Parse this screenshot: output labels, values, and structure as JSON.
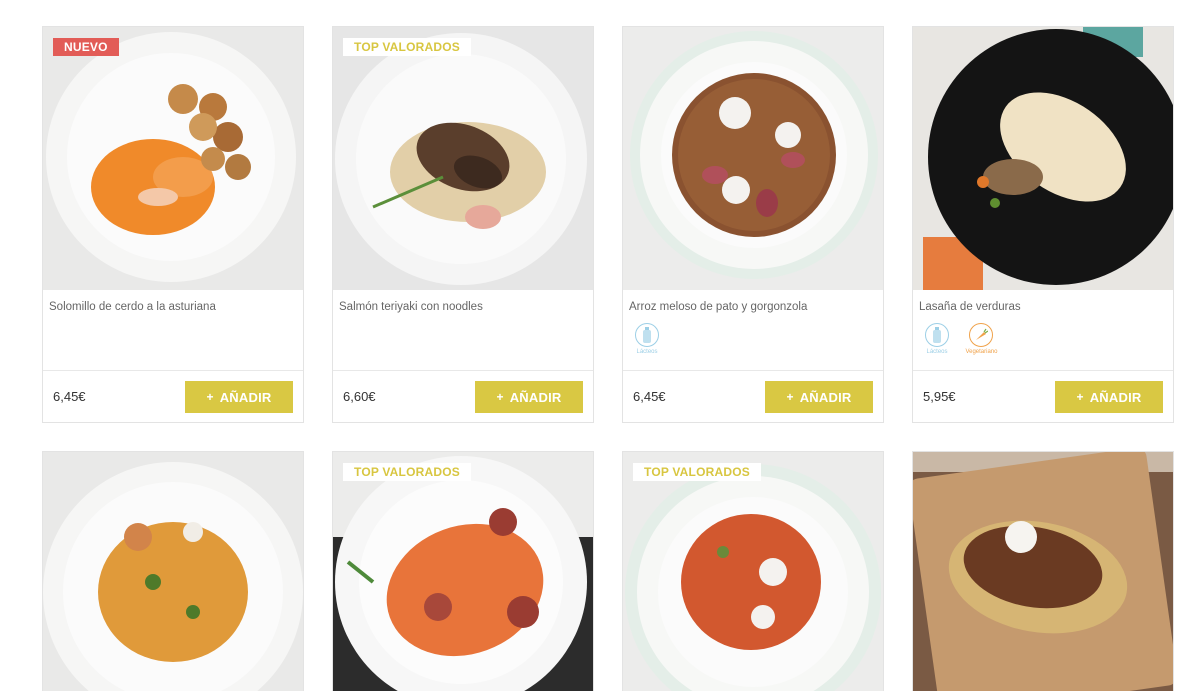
{
  "cards": [
    {
      "badge": "NUEVO",
      "badge_type": "new",
      "name": "Solomillo de cerdo a la asturiana",
      "price": "6,45€",
      "button": "AÑADIR",
      "plus": "+",
      "icons": []
    },
    {
      "badge": "TOP VALORADOS",
      "badge_type": "top",
      "name": "Salmón teriyaki con noodles",
      "price": "6,60€",
      "button": "AÑADIR",
      "plus": "+",
      "icons": []
    },
    {
      "badge": "",
      "badge_type": "",
      "name": "Arroz meloso de pato y gorgonzola",
      "price": "6,45€",
      "button": "AÑADIR",
      "plus": "+",
      "icons": [
        {
          "name": "bottle-icon",
          "label": "Lácteos"
        }
      ]
    },
    {
      "badge": "",
      "badge_type": "",
      "name": "Lasaña de verduras",
      "price": "5,95€",
      "button": "AÑADIR",
      "plus": "+",
      "icons": [
        {
          "name": "bottle-icon",
          "label": "Lácteos"
        },
        {
          "name": "carrot-icon",
          "label": "Vegetariano"
        }
      ]
    },
    {
      "badge": "",
      "badge_type": "",
      "name": "",
      "price": "",
      "button": "",
      "plus": "",
      "icons": []
    },
    {
      "badge": "TOP VALORADOS",
      "badge_type": "top",
      "name": "",
      "price": "",
      "button": "",
      "plus": "",
      "icons": []
    },
    {
      "badge": "TOP VALORADOS",
      "badge_type": "top",
      "name": "",
      "price": "",
      "button": "",
      "plus": "",
      "icons": []
    },
    {
      "badge": "",
      "badge_type": "",
      "name": "",
      "price": "",
      "button": "",
      "plus": "",
      "icons": []
    }
  ],
  "colors": {
    "accent": "#d9c843",
    "new_badge": "#e25c57",
    "icon_blue": "#9ccfe6",
    "icon_orange": "#f0a24a"
  }
}
